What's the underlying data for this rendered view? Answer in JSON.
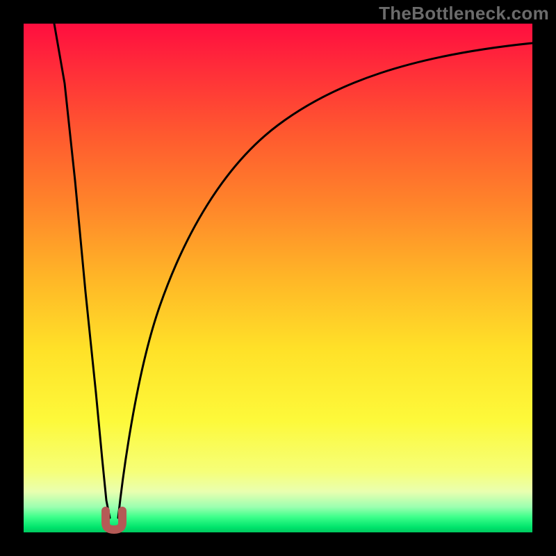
{
  "watermark": "TheBottleneck.com",
  "chart_data": {
    "type": "line",
    "title": "",
    "xlabel": "",
    "ylabel": "",
    "xlim": [
      0,
      100
    ],
    "ylim": [
      0,
      100
    ],
    "grid": false,
    "legend": false,
    "background_gradient": [
      {
        "stop": 0,
        "color": "#ff0e3f"
      },
      {
        "stop": 50,
        "color": "#ffb627"
      },
      {
        "stop": 78,
        "color": "#fdf93a"
      },
      {
        "stop": 97,
        "color": "#3cff8a"
      },
      {
        "stop": 100,
        "color": "#00c95f"
      }
    ],
    "series": [
      {
        "name": "bottleneck-curve",
        "x": [
          6,
          8,
          10,
          12,
          14,
          16,
          18,
          20,
          25,
          30,
          35,
          40,
          50,
          60,
          70,
          80,
          90,
          100
        ],
        "values": [
          100,
          78,
          56,
          35,
          15,
          3,
          2,
          12,
          35,
          51,
          62,
          70,
          80,
          86,
          90,
          93,
          95,
          96
        ]
      }
    ],
    "marker": {
      "name": "minimum-marker",
      "x": 16,
      "y": 2,
      "color": "#b55a56"
    }
  }
}
